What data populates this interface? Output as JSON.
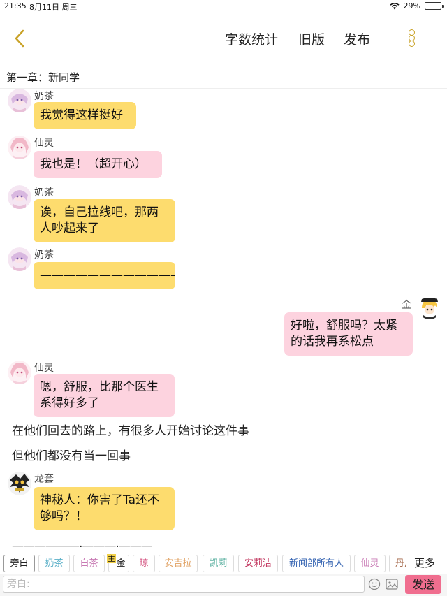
{
  "status": {
    "time": "21:35",
    "date": "8月11日 周三",
    "battery": "29%",
    "battery_level": 0.29
  },
  "nav": {
    "word_count": "字数统计",
    "old_version": "旧版",
    "publish": "发布"
  },
  "chapter": "第一章：新同学",
  "messages": [
    {
      "sender": "奶茶",
      "text": "我觉得这样挺好",
      "color": "#fddc6e"
    },
    {
      "sender": "仙灵",
      "text": "我也是！（超开心）",
      "color": "#fdd3df"
    },
    {
      "sender": "奶茶",
      "text_line1": "诶，自己拉线吧，那两",
      "text_line2": "人吵起来了",
      "color": "#fddc6e"
    },
    {
      "sender": "奶茶",
      "text": "————————————",
      "color": "#fddc6e"
    },
    {
      "sender": "金",
      "text_line1": "好啦，舒服吗？太紧",
      "text_line2": "的话我再系松点",
      "color": "#fdd3df"
    },
    {
      "sender": "仙灵",
      "text_line1": "嗯，舒服，比那个医生",
      "text_line2": "系得好多了",
      "color": "#fdd3df"
    },
    {
      "sender": "龙套",
      "text_line1": "神秘人：你害了Ta还不",
      "text_line2": "够吗？！",
      "color": "#fddc6e"
    }
  ],
  "narration": [
    "在他们回去的路上，有很多人开始讨论这件事",
    "但他们都没有当一回事"
  ],
  "trailing_line": "——————·———·———",
  "characters": [
    {
      "name": "旁白",
      "color": "#222222"
    },
    {
      "name": "奶茶",
      "color": "#5ab0c8"
    },
    {
      "name": "白茶",
      "color": "#c87ab4"
    },
    {
      "name": "金",
      "color": "#222222",
      "badge": "主"
    },
    {
      "name": "琼",
      "color": "#d24a7a"
    },
    {
      "name": "安吉拉",
      "color": "#e0a060"
    },
    {
      "name": "凯莉",
      "color": "#5ab0a0"
    },
    {
      "name": "安莉洁",
      "color": "#c0305a"
    },
    {
      "name": "新闻部所有人",
      "color": "#3060b0"
    },
    {
      "name": "仙灵",
      "color": "#c87ab4"
    },
    {
      "name": "丹尼",
      "color": "#a06040"
    }
  ],
  "more": "更多",
  "input_placeholder": "旁白:",
  "send": "发送"
}
